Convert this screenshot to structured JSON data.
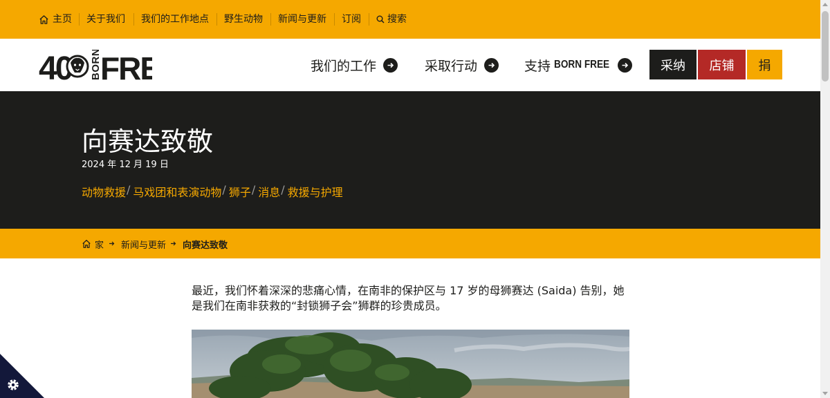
{
  "topnav": {
    "home": "主页",
    "about": "关于我们",
    "locations": "我们的工作地点",
    "wildlife": "野生动物",
    "news": "新闻与更新",
    "subscribe": "订阅",
    "search": "搜索"
  },
  "header": {
    "logo": "40 BORN FREE",
    "nav": {
      "our_work": "我们的工作",
      "take_action": "采取行动",
      "support": "支持",
      "support_brand": "BORN FREE"
    },
    "buttons": {
      "adopt": "采纳",
      "shop": "店铺",
      "donate": "捐"
    }
  },
  "article": {
    "title": "向赛达致敬",
    "date": "2024 年 12 月 19 日",
    "tags": [
      "动物救援",
      "马戏团和表演动物",
      "狮子",
      "消息",
      "救援与护理"
    ],
    "tag_separator": "/"
  },
  "breadcrumb": {
    "home": "家",
    "news": "新闻与更新",
    "current": "向赛达致敬"
  },
  "body": {
    "intro": "最近，我们怀着深深的悲痛心情，在南非的保护区与 17 岁的母狮赛达 (Saida) 告别，她是我们在南非获救的“封锁狮子会”狮群的珍贵成员。"
  },
  "colors": {
    "brand_yellow": "#f5a800",
    "dark": "#1d1d1b",
    "shop_red": "#b42926",
    "cookie_navy": "#13183a"
  },
  "icons": {
    "home": "home-icon",
    "search": "search-icon",
    "arrow": "arrow-right-circle-icon",
    "cookie": "gear-icon"
  }
}
